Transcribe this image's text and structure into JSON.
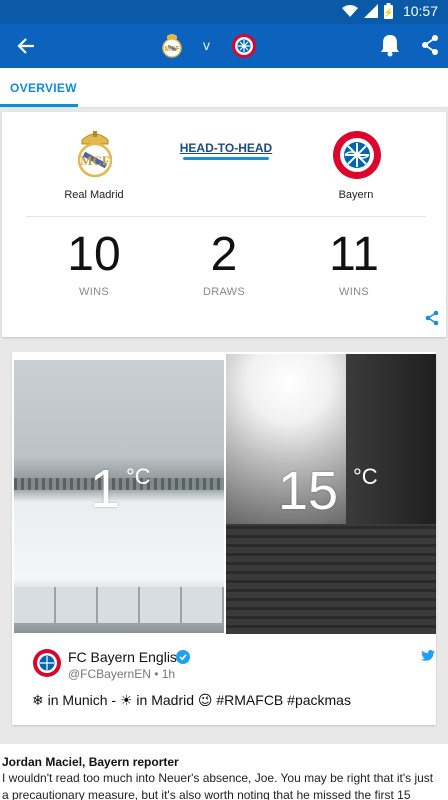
{
  "status_bar": {
    "time": "10:57",
    "icons": [
      "wifi-icon",
      "signal-icon",
      "battery-icon"
    ]
  },
  "app_bar": {
    "vs_label": "v",
    "home_team_crest": "real-madrid-crest",
    "away_team_crest": "fc-bayern-crest"
  },
  "tabs": [
    {
      "label": "OVERVIEW",
      "active": true
    }
  ],
  "head_to_head": {
    "title": "HEAD-TO-HEAD",
    "home_team": "Real Madrid",
    "away_team": "Bayern",
    "stats": [
      {
        "value": "10",
        "label": "WINS"
      },
      {
        "value": "2",
        "label": "DRAWS"
      },
      {
        "value": "11",
        "label": "WINS"
      }
    ]
  },
  "tweet": {
    "left_temp": "1",
    "right_temp": "15",
    "unit": "°C",
    "author": "FC Bayern English",
    "handle": "@FCBayernEN • 1h",
    "text": "❄ in Munich - ☀ in Madrid 😉 #RMAFCB #packmas"
  },
  "report": {
    "author": "Jordan Maciel, Bayern reporter",
    "line1": "I wouldn't read too much into Neuer's absence, Joe. You may be right that it's just",
    "line2": "a precautionary measure, but it's also worth noting that he missed the first 15"
  },
  "colors": {
    "status_bar": "#0b5aa8",
    "app_bar": "#0c63bd",
    "accent": "#0c8fd4",
    "h2h_title": "#1a4b84"
  }
}
